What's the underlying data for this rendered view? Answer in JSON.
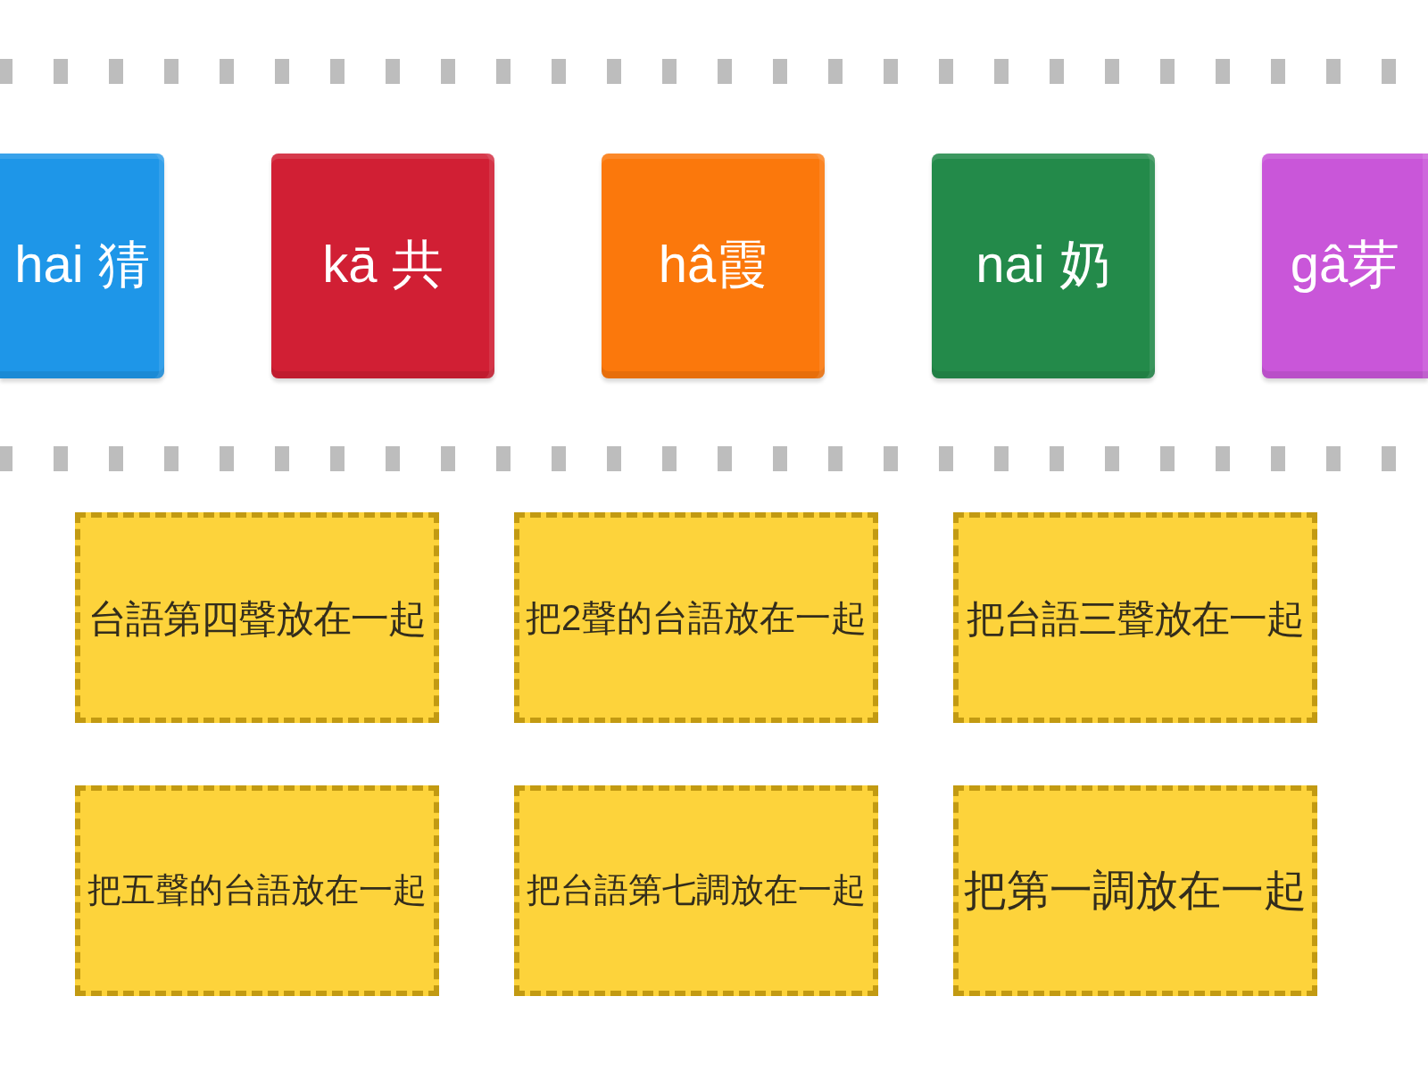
{
  "tiles": [
    {
      "label": "hai 猜",
      "color": "#1e96e8"
    },
    {
      "label": "kā 共",
      "color": "#d11f34"
    },
    {
      "label": "hâ霞",
      "color": "#fb780c"
    },
    {
      "label": "nai 奶",
      "color": "#238a4a"
    },
    {
      "label": "gâ芽",
      "color": "#c956d9"
    }
  ],
  "targets": [
    "台語第四聲放在一起",
    "把2聲的台語放在一起",
    "把台語三聲放在一起",
    "把五聲的台語放在一起",
    "把台語第七調放在一起",
    "把第一調放在一起"
  ]
}
